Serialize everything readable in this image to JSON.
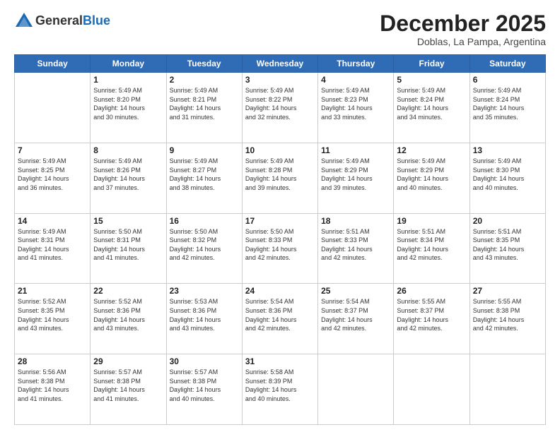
{
  "header": {
    "logo_line1": "General",
    "logo_line2": "Blue",
    "month": "December 2025",
    "location": "Doblas, La Pampa, Argentina"
  },
  "days_of_week": [
    "Sunday",
    "Monday",
    "Tuesday",
    "Wednesday",
    "Thursday",
    "Friday",
    "Saturday"
  ],
  "weeks": [
    [
      {
        "day": "",
        "info": ""
      },
      {
        "day": "1",
        "info": "Sunrise: 5:49 AM\nSunset: 8:20 PM\nDaylight: 14 hours\nand 30 minutes."
      },
      {
        "day": "2",
        "info": "Sunrise: 5:49 AM\nSunset: 8:21 PM\nDaylight: 14 hours\nand 31 minutes."
      },
      {
        "day": "3",
        "info": "Sunrise: 5:49 AM\nSunset: 8:22 PM\nDaylight: 14 hours\nand 32 minutes."
      },
      {
        "day": "4",
        "info": "Sunrise: 5:49 AM\nSunset: 8:23 PM\nDaylight: 14 hours\nand 33 minutes."
      },
      {
        "day": "5",
        "info": "Sunrise: 5:49 AM\nSunset: 8:24 PM\nDaylight: 14 hours\nand 34 minutes."
      },
      {
        "day": "6",
        "info": "Sunrise: 5:49 AM\nSunset: 8:24 PM\nDaylight: 14 hours\nand 35 minutes."
      }
    ],
    [
      {
        "day": "7",
        "info": "Sunrise: 5:49 AM\nSunset: 8:25 PM\nDaylight: 14 hours\nand 36 minutes."
      },
      {
        "day": "8",
        "info": "Sunrise: 5:49 AM\nSunset: 8:26 PM\nDaylight: 14 hours\nand 37 minutes."
      },
      {
        "day": "9",
        "info": "Sunrise: 5:49 AM\nSunset: 8:27 PM\nDaylight: 14 hours\nand 38 minutes."
      },
      {
        "day": "10",
        "info": "Sunrise: 5:49 AM\nSunset: 8:28 PM\nDaylight: 14 hours\nand 39 minutes."
      },
      {
        "day": "11",
        "info": "Sunrise: 5:49 AM\nSunset: 8:29 PM\nDaylight: 14 hours\nand 39 minutes."
      },
      {
        "day": "12",
        "info": "Sunrise: 5:49 AM\nSunset: 8:29 PM\nDaylight: 14 hours\nand 40 minutes."
      },
      {
        "day": "13",
        "info": "Sunrise: 5:49 AM\nSunset: 8:30 PM\nDaylight: 14 hours\nand 40 minutes."
      }
    ],
    [
      {
        "day": "14",
        "info": "Sunrise: 5:49 AM\nSunset: 8:31 PM\nDaylight: 14 hours\nand 41 minutes."
      },
      {
        "day": "15",
        "info": "Sunrise: 5:50 AM\nSunset: 8:31 PM\nDaylight: 14 hours\nand 41 minutes."
      },
      {
        "day": "16",
        "info": "Sunrise: 5:50 AM\nSunset: 8:32 PM\nDaylight: 14 hours\nand 42 minutes."
      },
      {
        "day": "17",
        "info": "Sunrise: 5:50 AM\nSunset: 8:33 PM\nDaylight: 14 hours\nand 42 minutes."
      },
      {
        "day": "18",
        "info": "Sunrise: 5:51 AM\nSunset: 8:33 PM\nDaylight: 14 hours\nand 42 minutes."
      },
      {
        "day": "19",
        "info": "Sunrise: 5:51 AM\nSunset: 8:34 PM\nDaylight: 14 hours\nand 42 minutes."
      },
      {
        "day": "20",
        "info": "Sunrise: 5:51 AM\nSunset: 8:35 PM\nDaylight: 14 hours\nand 43 minutes."
      }
    ],
    [
      {
        "day": "21",
        "info": "Sunrise: 5:52 AM\nSunset: 8:35 PM\nDaylight: 14 hours\nand 43 minutes."
      },
      {
        "day": "22",
        "info": "Sunrise: 5:52 AM\nSunset: 8:36 PM\nDaylight: 14 hours\nand 43 minutes."
      },
      {
        "day": "23",
        "info": "Sunrise: 5:53 AM\nSunset: 8:36 PM\nDaylight: 14 hours\nand 43 minutes."
      },
      {
        "day": "24",
        "info": "Sunrise: 5:54 AM\nSunset: 8:36 PM\nDaylight: 14 hours\nand 42 minutes."
      },
      {
        "day": "25",
        "info": "Sunrise: 5:54 AM\nSunset: 8:37 PM\nDaylight: 14 hours\nand 42 minutes."
      },
      {
        "day": "26",
        "info": "Sunrise: 5:55 AM\nSunset: 8:37 PM\nDaylight: 14 hours\nand 42 minutes."
      },
      {
        "day": "27",
        "info": "Sunrise: 5:55 AM\nSunset: 8:38 PM\nDaylight: 14 hours\nand 42 minutes."
      }
    ],
    [
      {
        "day": "28",
        "info": "Sunrise: 5:56 AM\nSunset: 8:38 PM\nDaylight: 14 hours\nand 41 minutes."
      },
      {
        "day": "29",
        "info": "Sunrise: 5:57 AM\nSunset: 8:38 PM\nDaylight: 14 hours\nand 41 minutes."
      },
      {
        "day": "30",
        "info": "Sunrise: 5:57 AM\nSunset: 8:38 PM\nDaylight: 14 hours\nand 40 minutes."
      },
      {
        "day": "31",
        "info": "Sunrise: 5:58 AM\nSunset: 8:39 PM\nDaylight: 14 hours\nand 40 minutes."
      },
      {
        "day": "",
        "info": ""
      },
      {
        "day": "",
        "info": ""
      },
      {
        "day": "",
        "info": ""
      }
    ]
  ]
}
